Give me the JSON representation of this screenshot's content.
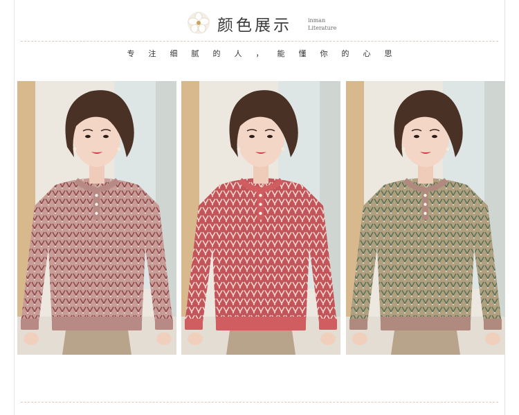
{
  "header": {
    "title": "颜色展示",
    "sub_line1": "inman",
    "sub_line2": "Literature",
    "slogan": "专注细腻的人，能懂你的心思"
  },
  "photos": [
    {
      "color_name": "pink-beige",
      "body_color": "#c89d97",
      "trim_color": "#b88a86",
      "pattern_color": "#8f4a4e"
    },
    {
      "color_name": "red",
      "body_color": "#c2555a",
      "trim_color": "#d05d5f",
      "pattern_color": "#f3d7cf"
    },
    {
      "color_name": "green-beige",
      "body_color": "#b1a080",
      "trim_color": "#b0897f",
      "pattern_color": "#5a7358"
    }
  ],
  "colors": {
    "accent": "#d8cdb4",
    "text": "#333333"
  }
}
